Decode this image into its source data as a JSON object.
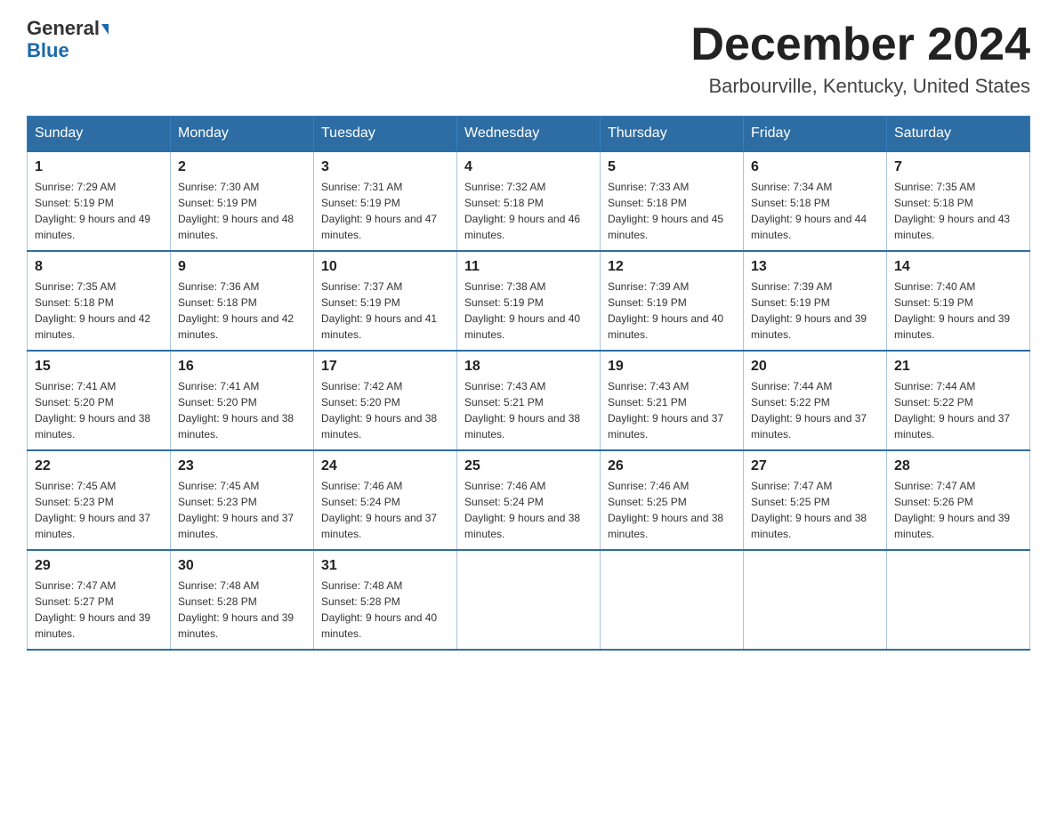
{
  "header": {
    "logo_line1": "General",
    "logo_line2": "Blue",
    "month_title": "December 2024",
    "location": "Barbourville, Kentucky, United States"
  },
  "weekdays": [
    "Sunday",
    "Monday",
    "Tuesday",
    "Wednesday",
    "Thursday",
    "Friday",
    "Saturday"
  ],
  "weeks": [
    [
      {
        "day": "1",
        "sunrise": "7:29 AM",
        "sunset": "5:19 PM",
        "daylight": "9 hours and 49 minutes."
      },
      {
        "day": "2",
        "sunrise": "7:30 AM",
        "sunset": "5:19 PM",
        "daylight": "9 hours and 48 minutes."
      },
      {
        "day": "3",
        "sunrise": "7:31 AM",
        "sunset": "5:19 PM",
        "daylight": "9 hours and 47 minutes."
      },
      {
        "day": "4",
        "sunrise": "7:32 AM",
        "sunset": "5:18 PM",
        "daylight": "9 hours and 46 minutes."
      },
      {
        "day": "5",
        "sunrise": "7:33 AM",
        "sunset": "5:18 PM",
        "daylight": "9 hours and 45 minutes."
      },
      {
        "day": "6",
        "sunrise": "7:34 AM",
        "sunset": "5:18 PM",
        "daylight": "9 hours and 44 minutes."
      },
      {
        "day": "7",
        "sunrise": "7:35 AM",
        "sunset": "5:18 PM",
        "daylight": "9 hours and 43 minutes."
      }
    ],
    [
      {
        "day": "8",
        "sunrise": "7:35 AM",
        "sunset": "5:18 PM",
        "daylight": "9 hours and 42 minutes."
      },
      {
        "day": "9",
        "sunrise": "7:36 AM",
        "sunset": "5:18 PM",
        "daylight": "9 hours and 42 minutes."
      },
      {
        "day": "10",
        "sunrise": "7:37 AM",
        "sunset": "5:19 PM",
        "daylight": "9 hours and 41 minutes."
      },
      {
        "day": "11",
        "sunrise": "7:38 AM",
        "sunset": "5:19 PM",
        "daylight": "9 hours and 40 minutes."
      },
      {
        "day": "12",
        "sunrise": "7:39 AM",
        "sunset": "5:19 PM",
        "daylight": "9 hours and 40 minutes."
      },
      {
        "day": "13",
        "sunrise": "7:39 AM",
        "sunset": "5:19 PM",
        "daylight": "9 hours and 39 minutes."
      },
      {
        "day": "14",
        "sunrise": "7:40 AM",
        "sunset": "5:19 PM",
        "daylight": "9 hours and 39 minutes."
      }
    ],
    [
      {
        "day": "15",
        "sunrise": "7:41 AM",
        "sunset": "5:20 PM",
        "daylight": "9 hours and 38 minutes."
      },
      {
        "day": "16",
        "sunrise": "7:41 AM",
        "sunset": "5:20 PM",
        "daylight": "9 hours and 38 minutes."
      },
      {
        "day": "17",
        "sunrise": "7:42 AM",
        "sunset": "5:20 PM",
        "daylight": "9 hours and 38 minutes."
      },
      {
        "day": "18",
        "sunrise": "7:43 AM",
        "sunset": "5:21 PM",
        "daylight": "9 hours and 38 minutes."
      },
      {
        "day": "19",
        "sunrise": "7:43 AM",
        "sunset": "5:21 PM",
        "daylight": "9 hours and 37 minutes."
      },
      {
        "day": "20",
        "sunrise": "7:44 AM",
        "sunset": "5:22 PM",
        "daylight": "9 hours and 37 minutes."
      },
      {
        "day": "21",
        "sunrise": "7:44 AM",
        "sunset": "5:22 PM",
        "daylight": "9 hours and 37 minutes."
      }
    ],
    [
      {
        "day": "22",
        "sunrise": "7:45 AM",
        "sunset": "5:23 PM",
        "daylight": "9 hours and 37 minutes."
      },
      {
        "day": "23",
        "sunrise": "7:45 AM",
        "sunset": "5:23 PM",
        "daylight": "9 hours and 37 minutes."
      },
      {
        "day": "24",
        "sunrise": "7:46 AM",
        "sunset": "5:24 PM",
        "daylight": "9 hours and 37 minutes."
      },
      {
        "day": "25",
        "sunrise": "7:46 AM",
        "sunset": "5:24 PM",
        "daylight": "9 hours and 38 minutes."
      },
      {
        "day": "26",
        "sunrise": "7:46 AM",
        "sunset": "5:25 PM",
        "daylight": "9 hours and 38 minutes."
      },
      {
        "day": "27",
        "sunrise": "7:47 AM",
        "sunset": "5:25 PM",
        "daylight": "9 hours and 38 minutes."
      },
      {
        "day": "28",
        "sunrise": "7:47 AM",
        "sunset": "5:26 PM",
        "daylight": "9 hours and 39 minutes."
      }
    ],
    [
      {
        "day": "29",
        "sunrise": "7:47 AM",
        "sunset": "5:27 PM",
        "daylight": "9 hours and 39 minutes."
      },
      {
        "day": "30",
        "sunrise": "7:48 AM",
        "sunset": "5:28 PM",
        "daylight": "9 hours and 39 minutes."
      },
      {
        "day": "31",
        "sunrise": "7:48 AM",
        "sunset": "5:28 PM",
        "daylight": "9 hours and 40 minutes."
      },
      null,
      null,
      null,
      null
    ]
  ]
}
